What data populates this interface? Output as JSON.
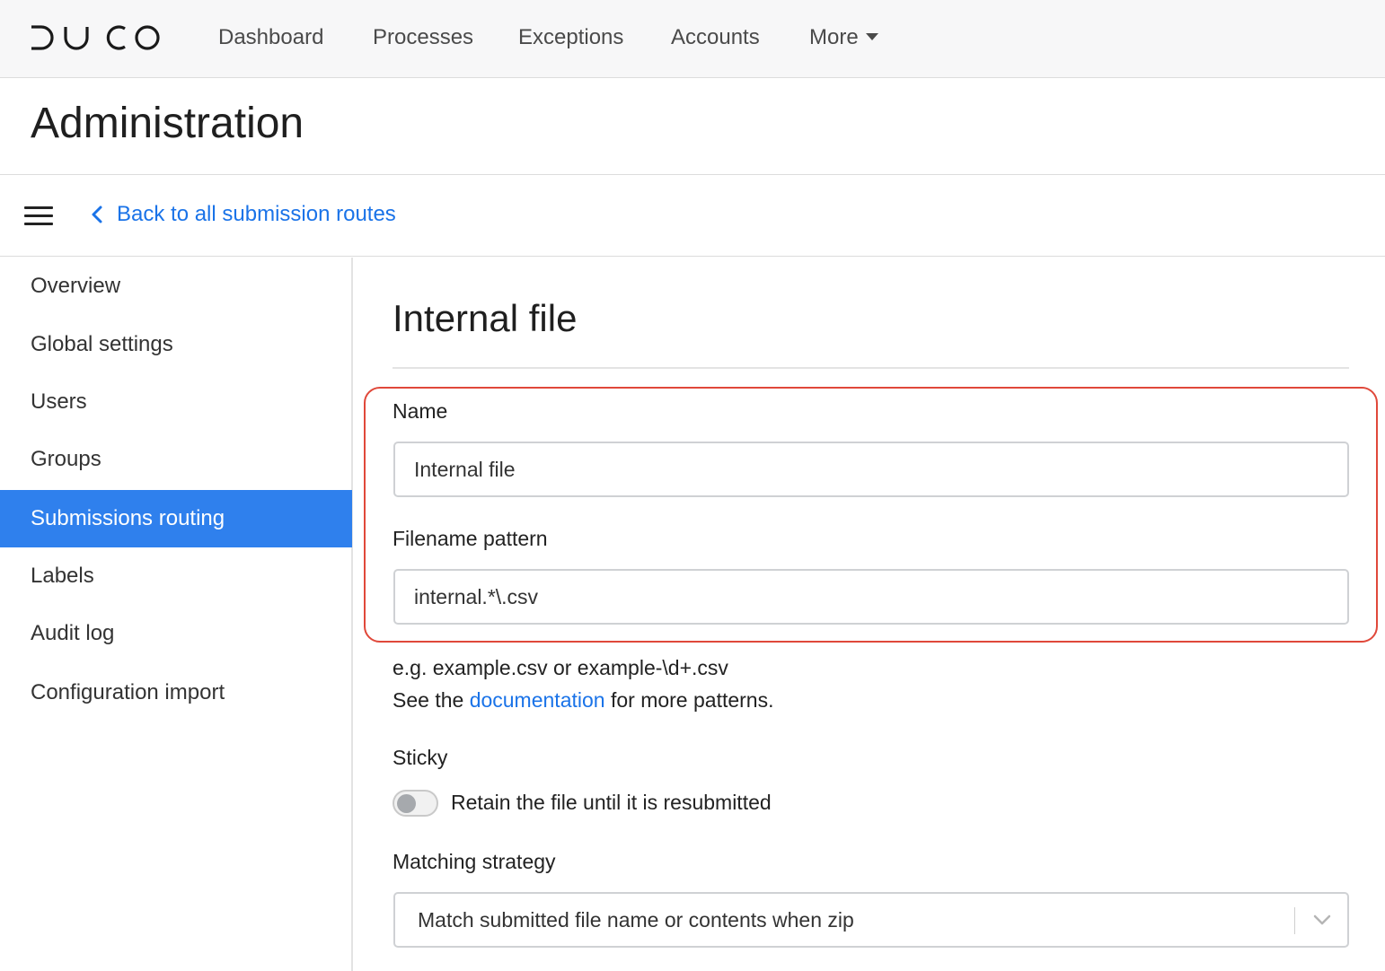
{
  "topnav": {
    "brand": "DUCO",
    "items": [
      {
        "label": "Dashboard"
      },
      {
        "label": "Processes"
      },
      {
        "label": "Exceptions"
      },
      {
        "label": "Accounts"
      },
      {
        "label": "More"
      }
    ]
  },
  "header": {
    "title": "Administration"
  },
  "subbar": {
    "back_label": "Back to all submission routes"
  },
  "sidebar": {
    "items": [
      {
        "label": "Overview"
      },
      {
        "label": "Global settings"
      },
      {
        "label": "Users"
      },
      {
        "label": "Groups"
      },
      {
        "label": "Submissions routing",
        "active": true
      },
      {
        "label": "Labels"
      },
      {
        "label": "Audit log"
      },
      {
        "label": "Configuration import"
      }
    ]
  },
  "form": {
    "title": "Internal file",
    "name_label": "Name",
    "name_value": "Internal file",
    "pattern_label": "Filename pattern",
    "pattern_value": "internal.*\\.csv",
    "help_line1": "e.g. example.csv or example-\\d+.csv",
    "help_prefix": "See the ",
    "help_link": "documentation",
    "help_suffix": " for more patterns.",
    "sticky_label": "Sticky",
    "sticky_toggle_label": "Retain the file until it is resubmitted",
    "sticky_enabled": false,
    "matching_label": "Matching strategy",
    "matching_value": "Match submitted file name or contents when zip"
  },
  "colors": {
    "accent": "#2f80ed",
    "link": "#1a73e8",
    "highlight": "#e0483a"
  }
}
